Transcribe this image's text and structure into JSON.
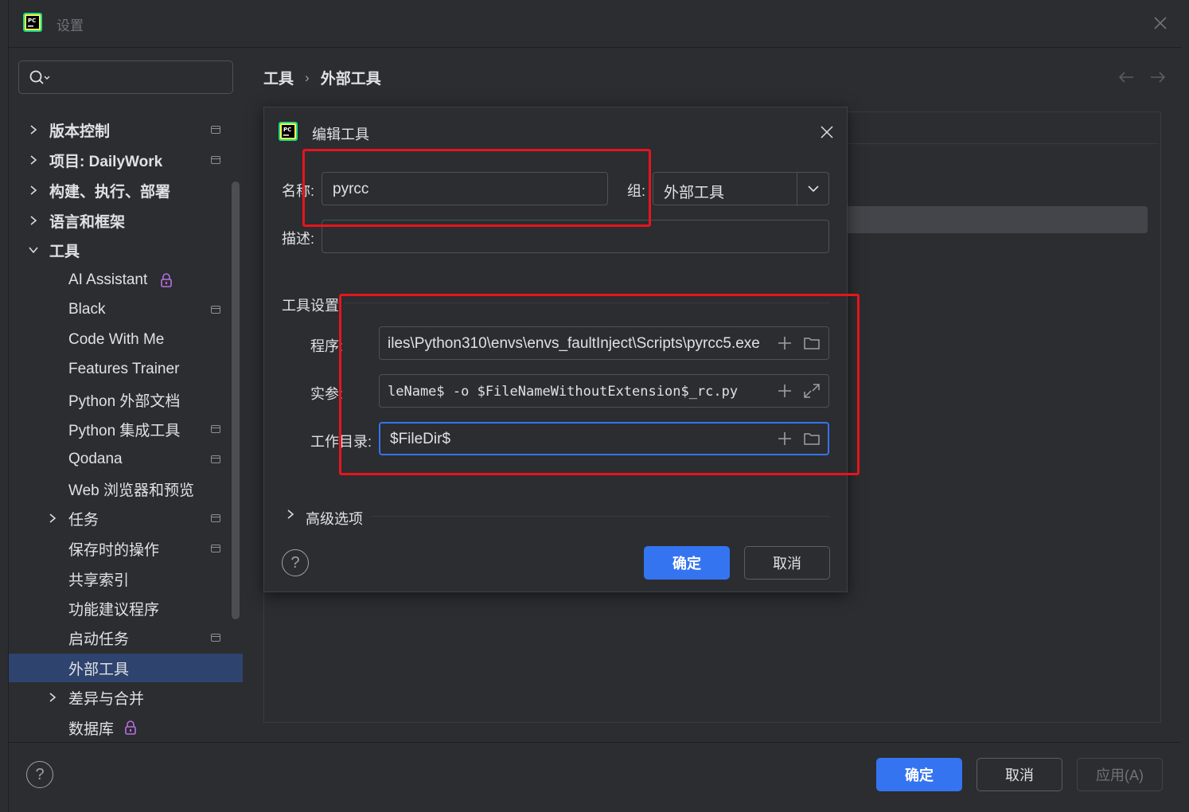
{
  "window": {
    "title": "设置"
  },
  "search": {
    "placeholder": ""
  },
  "sidebar": {
    "items": [
      {
        "label": "版本控制",
        "bold": true,
        "chevron": "right",
        "project": true
      },
      {
        "label": "项目: DailyWork",
        "bold": true,
        "chevron": "right",
        "project": true
      },
      {
        "label": "构建、执行、部署",
        "bold": true,
        "chevron": "right",
        "project": false
      },
      {
        "label": "语言和框架",
        "bold": true,
        "chevron": "right",
        "project": false
      },
      {
        "label": "工具",
        "bold": true,
        "chevron": "down",
        "project": false
      },
      {
        "label": "AI Assistant",
        "lock": true
      },
      {
        "label": "Black",
        "project": true
      },
      {
        "label": "Code With Me"
      },
      {
        "label": "Features Trainer"
      },
      {
        "label": "Python 外部文档"
      },
      {
        "label": "Python 集成工具",
        "project": true
      },
      {
        "label": "Qodana",
        "project": true
      },
      {
        "label": "Web 浏览器和预览"
      },
      {
        "label": "任务",
        "chevron": "right",
        "project": true
      },
      {
        "label": "保存时的操作",
        "project": true
      },
      {
        "label": "共享索引"
      },
      {
        "label": "功能建议程序"
      },
      {
        "label": "启动任务",
        "project": true
      },
      {
        "label": "外部工具",
        "selected": true
      },
      {
        "label": "差异与合并",
        "chevron": "right"
      },
      {
        "label": "数据库",
        "lock": true
      }
    ]
  },
  "breadcrumb": {
    "parent": "工具",
    "separator": "›",
    "current": "外部工具"
  },
  "dialog": {
    "title": "编辑工具",
    "name_label": "名称:",
    "name_value": "pyrcc",
    "group_label": "组:",
    "group_value": "外部工具",
    "desc_label": "描述:",
    "desc_value": "",
    "section_title": "工具设置",
    "program_label": "程序:",
    "program_value": "iles\\Python310\\envs\\envs_faultInject\\Scripts\\pyrcc5.exe",
    "args_label": "实参:",
    "args_value": "leName$ -o $FileNameWithoutExtension$_rc.py",
    "workdir_label": "工作目录:",
    "workdir_value": "$FileDir$",
    "advanced_label": "高级选项",
    "ok_label": "确定",
    "cancel_label": "取消",
    "help_label": "?"
  },
  "footer": {
    "help_label": "?",
    "ok_label": "确定",
    "cancel_label": "取消",
    "apply_label": "应用(A)"
  },
  "colors": {
    "accent": "#3574f0",
    "highlight": "#e8141c",
    "selected": "#2e436e",
    "lock": "#b96fe0"
  }
}
